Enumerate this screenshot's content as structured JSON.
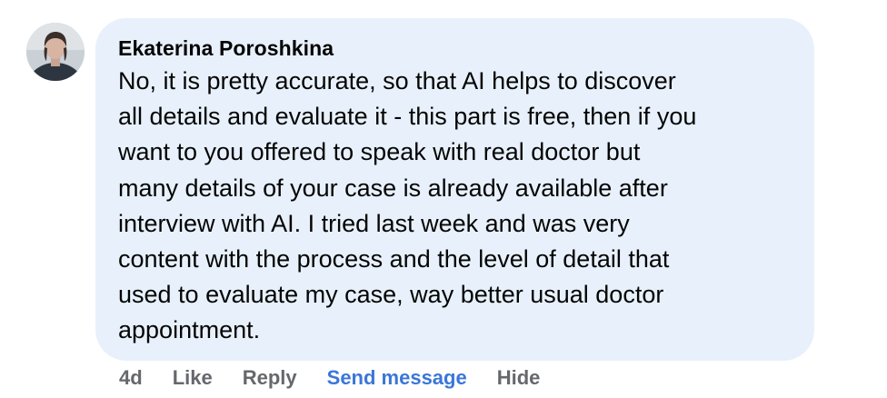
{
  "comment": {
    "author": "Ekaterina Poroshkina",
    "text": "No, it is pretty accurate, so that AI helps to discover\nall details and evaluate it - this part is free, then if you\nwant to you offered to speak with real doctor but\nmany details of your case is already available after\ninterview with AI. I tried last week and was very\ncontent with the process and the level of detail that\nused to evaluate my case, way better usual doctor\nappointment.",
    "timestamp": "4d",
    "actions": {
      "like": "Like",
      "reply": "Reply",
      "send_message": "Send message",
      "hide": "Hide"
    }
  },
  "colors": {
    "bubble_background": "#e8f1fb",
    "text": "#050505",
    "action_text": "#65686c",
    "link_blue": "#3b76d8"
  },
  "icons": {
    "avatar": "profile-photo"
  }
}
